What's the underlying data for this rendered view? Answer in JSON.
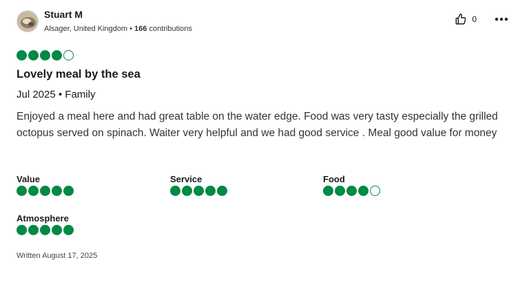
{
  "reviewer": {
    "name": "Stuart M",
    "location": "Alsager, United Kingdom",
    "separator": " • ",
    "contributions_count": "166",
    "contributions_label": " contributions"
  },
  "actions": {
    "like_count": "0",
    "like_icon": "thumbs-up-icon",
    "more_icon": "more-options-icon"
  },
  "review": {
    "rating": 4,
    "rating_max": 5,
    "title": "Lovely meal by the sea",
    "date_trip": "Jul 2025 • Family",
    "text": "Enjoyed a meal here and had great table on the water edge. Food was very tasty especially the grilled octopus served on spinach. Waiter very helpful and we had good service . Meal good value for money",
    "subratings": [
      {
        "label": "Value",
        "rating": 5
      },
      {
        "label": "Service",
        "rating": 5
      },
      {
        "label": "Food",
        "rating": 4
      },
      {
        "label": "Atmosphere",
        "rating": 5
      }
    ],
    "written": "Written August 17, 2025"
  },
  "colors": {
    "bubble": "#008a45",
    "text": "#1a1a1a"
  }
}
